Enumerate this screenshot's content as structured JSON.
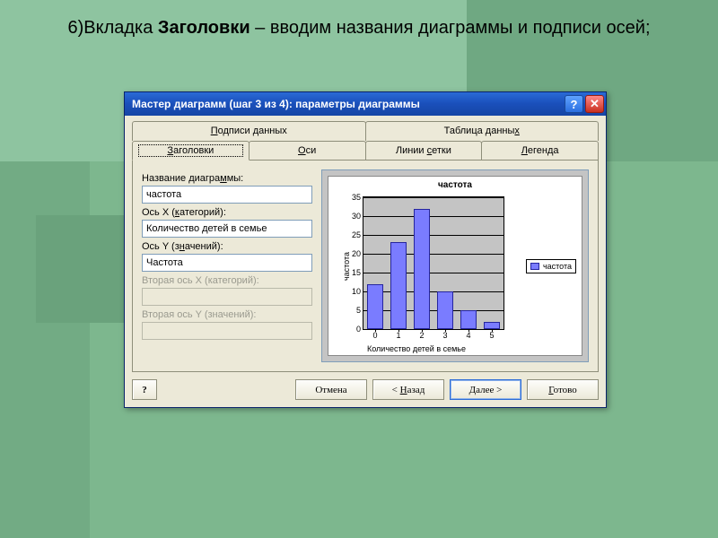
{
  "slide": {
    "prefix": "6)Вкладка ",
    "bold_word": "Заголовки",
    "suffix": " – вводим названия диаграммы и подписи осей;"
  },
  "titlebar": {
    "title": "Мастер диаграмм (шаг 3 из 4): параметры диаграммы"
  },
  "tabs": {
    "top": [
      {
        "label_pre": "",
        "u": "П",
        "label_post": "одписи данных"
      },
      {
        "label_pre": "Таблица данны",
        "u": "х",
        "label_post": ""
      }
    ],
    "bottom": [
      {
        "label_pre": "",
        "u": "З",
        "label_post": "аголовки",
        "active": true
      },
      {
        "label_pre": "",
        "u": "О",
        "label_post": "си"
      },
      {
        "label_pre": "Линии ",
        "u": "с",
        "label_post": "етки"
      },
      {
        "label_pre": "",
        "u": "Л",
        "label_post": "егенда"
      }
    ]
  },
  "fields": {
    "chart_title": {
      "label_pre": "Название диагра",
      "u": "м",
      "label_post": "мы:",
      "value": "частота",
      "disabled": false
    },
    "x_axis": {
      "label_pre": "Ось X (",
      "u": "к",
      "label_post": "атегорий):",
      "value": "Количество детей в семье",
      "disabled": false
    },
    "y_axis": {
      "label_pre": "Ось Y (з",
      "u": "н",
      "label_post": "ачений):",
      "value": "Частота",
      "disabled": false
    },
    "x2_axis": {
      "label_pre": "Вторая ось X (категорий):",
      "u": "",
      "label_post": "",
      "value": "",
      "disabled": true
    },
    "y2_axis": {
      "label_pre": "Вторая ось Y (значений):",
      "u": "",
      "label_post": "",
      "value": "",
      "disabled": true
    }
  },
  "chart_data": {
    "type": "bar",
    "title": "частота",
    "xlabel": "Количество детей в семье",
    "ylabel": "частота",
    "categories": [
      "0",
      "1",
      "2",
      "3",
      "4",
      "5"
    ],
    "values": [
      12,
      23,
      32,
      10,
      5,
      2
    ],
    "ylim": [
      0,
      35
    ],
    "ytick_step": 5,
    "legend": [
      "частота"
    ]
  },
  "buttons": {
    "help_icon": "?",
    "cancel": "Отмена",
    "back_pre": "< ",
    "back_u": "Н",
    "back_post": "азад",
    "next_pre": "",
    "next_u": "Д",
    "next_post": "алее >",
    "finish_pre": "",
    "finish_u": "Г",
    "finish_post": "отово"
  }
}
